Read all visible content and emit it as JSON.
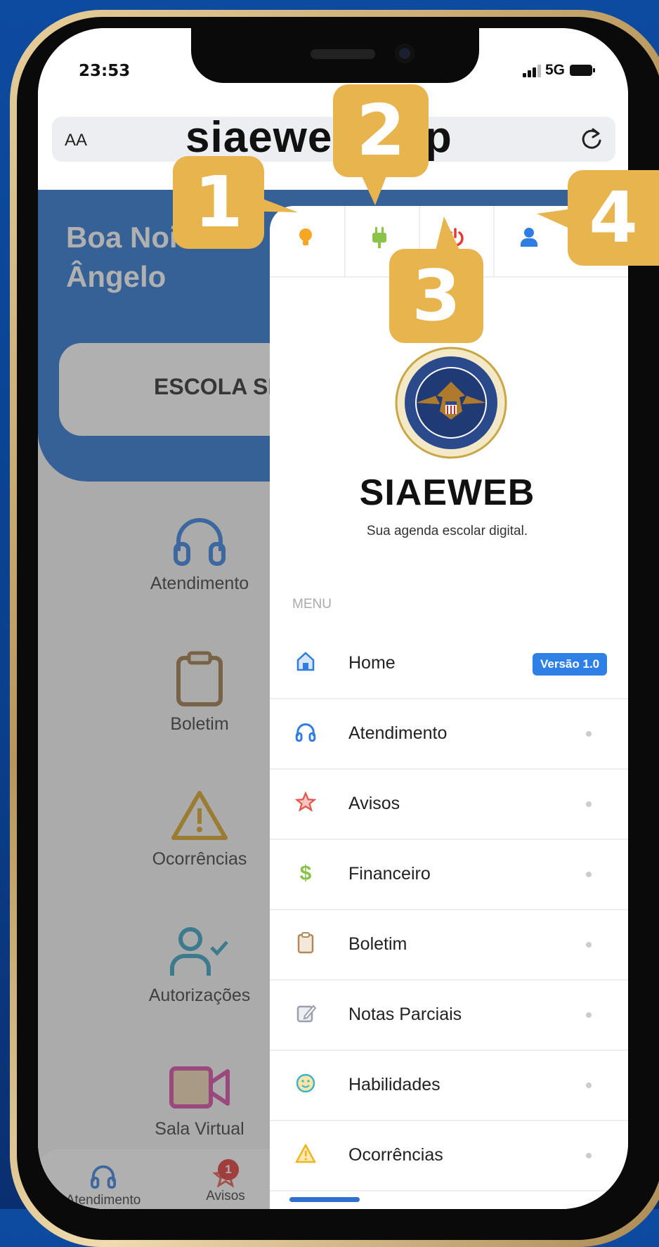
{
  "status": {
    "time": "23:53",
    "network": "5G"
  },
  "browser": {
    "aa_label": "AA",
    "url": "siaeweb.app"
  },
  "app": {
    "greeting_line1": "Boa Noi",
    "greeting_line2": "Ângelo",
    "school": "ESCOLA SI",
    "tiles": [
      "Atendimento",
      "Boletim",
      "Ocorrências",
      "Autorizações",
      "Sala Virtual"
    ],
    "tabbar": [
      {
        "label": "Atendimento",
        "icon": "headphones-icon"
      },
      {
        "label": "Avisos",
        "icon": "star-icon",
        "badge": "1"
      }
    ]
  },
  "drawer": {
    "top_icons": [
      "lightbulb-icon",
      "plug-icon",
      "power-icon",
      "user-icon"
    ],
    "brand": "SIAEWEB",
    "tagline": "Sua agenda escolar digital.",
    "menu_heading": "MENU",
    "items": [
      {
        "label": "Home",
        "icon": "home-icon",
        "badge": "Versão 1.0"
      },
      {
        "label": "Atendimento",
        "icon": "headphones-icon"
      },
      {
        "label": "Avisos",
        "icon": "star-icon"
      },
      {
        "label": "Financeiro",
        "icon": "dollar-icon"
      },
      {
        "label": "Boletim",
        "icon": "clipboard-icon"
      },
      {
        "label": "Notas Parciais",
        "icon": "edit-icon"
      },
      {
        "label": "Habilidades",
        "icon": "smile-icon"
      },
      {
        "label": "Ocorrências",
        "icon": "warning-icon"
      }
    ]
  },
  "callouts": [
    "1",
    "2",
    "3",
    "4"
  ],
  "colors": {
    "primary": "#1f6fcf",
    "callout": "#e8b44e",
    "version_badge": "#2f80e6",
    "power": "#e53935"
  }
}
